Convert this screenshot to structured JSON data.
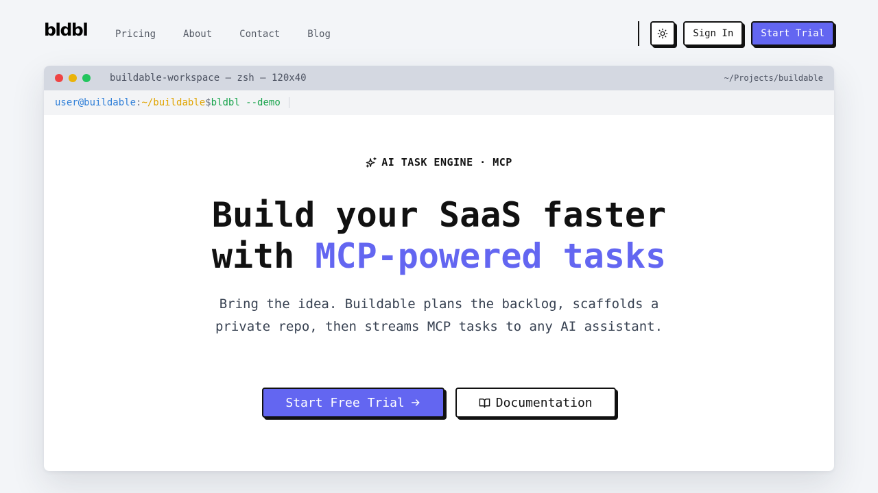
{
  "nav": {
    "logo": "bldbl",
    "links": [
      "Pricing",
      "About",
      "Contact",
      "Blog"
    ],
    "theme_icon": "sun-icon",
    "sign_in": "Sign In",
    "start_trial": "Start Trial"
  },
  "window": {
    "title": "buildable-workspace — zsh — 120x40",
    "path": "~/Projects/buildable",
    "prompt": {
      "user": "user@buildable",
      "sep": ":",
      "dir": "~/buildable",
      "dollar": "$",
      "command": "bldbl --demo"
    }
  },
  "hero": {
    "badge_icon": "sparkle-icon",
    "badge": "AI TASK ENGINE · MCP",
    "headline_line1": "Build your SaaS faster",
    "headline_line2_prefix": "with",
    "headline_accent": "MCP-powered tasks",
    "subtitle": "Bring the idea. Buildable plans the backlog, scaffolds a private repo, then streams MCP tasks to any AI assistant.",
    "cta_primary": "Start Free Trial",
    "cta_primary_icon": "arrow-right-icon",
    "cta_secondary": "Documentation",
    "cta_secondary_icon": "book-icon"
  },
  "colors": {
    "accent": "#6366f1",
    "titlebar": "#d4d8e1",
    "prompt_user": "#2f7fd8",
    "prompt_dir": "#e0a400",
    "prompt_cmd": "#16a34a"
  }
}
